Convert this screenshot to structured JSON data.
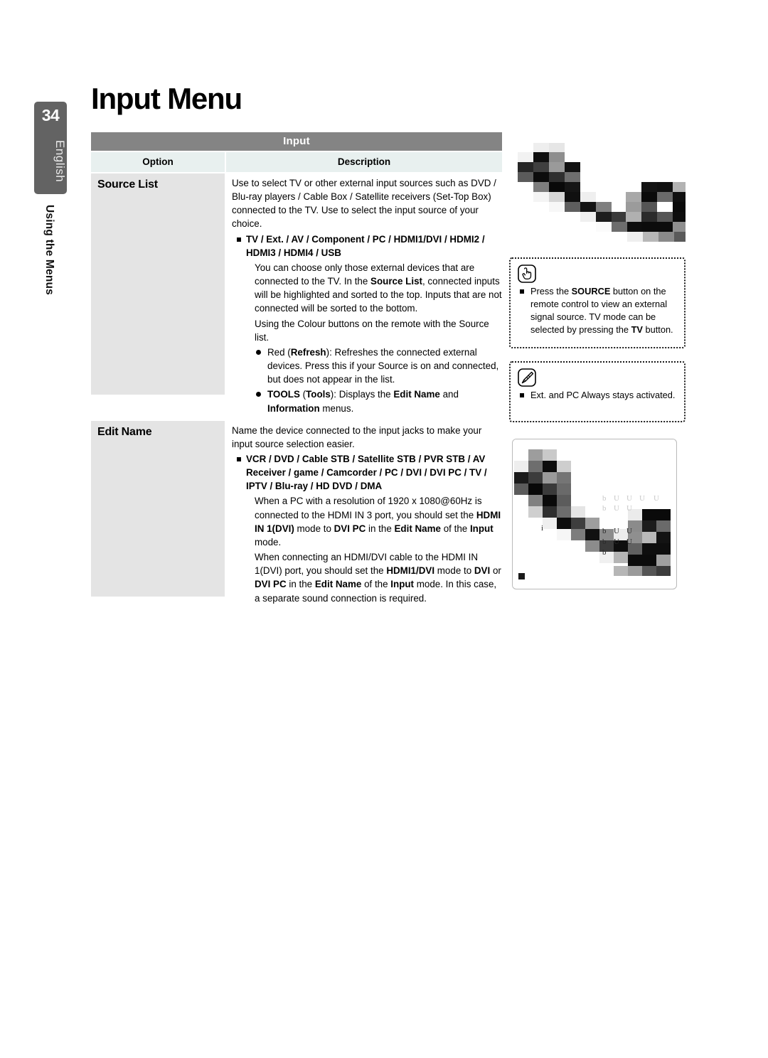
{
  "page": {
    "number": "34",
    "language": "English",
    "section": "Using the Menus",
    "title": "Input Menu"
  },
  "table": {
    "title": "Input",
    "headers": {
      "option": "Option",
      "description": "Description"
    },
    "rows": [
      {
        "option": "Source List",
        "intro": "Use to select TV or other external input sources such as DVD / Blu-ray players / Cable Box / Satellite receivers (Set-Top Box) connected to the TV. Use to select the input source of your choice.",
        "bullet_bold": "TV / Ext. / AV / Component / PC / HDMI1/DVI / HDMI2 / HDMI3 / HDMI4 / USB",
        "para_1_a": "You can choose only those external devices that are connected to the TV. In the ",
        "para_1_b": "Source List",
        "para_1_c": ", connected inputs will be highlighted and sorted to the top. Inputs that are not connected will be sorted to the bottom.",
        "para_2": "Using the Colour buttons on the remote with the Source list.",
        "dot_1_a": "Red (",
        "dot_1_b": "Refresh",
        "dot_1_c": "): Refreshes the connected external devices. Press this if your Source is on and connected, but does not appear in the list.",
        "dot_2_a": "TOOLS",
        "dot_2_b": " (",
        "dot_2_c": "Tools",
        "dot_2_d": "): Displays the ",
        "dot_2_e": "Edit Name",
        "dot_2_f": " and ",
        "dot_2_g": "Information",
        "dot_2_h": " menus."
      },
      {
        "option": "Edit Name",
        "intro": "Name the device connected to the input jacks to make your input source selection easier.",
        "bullet_bold": "VCR / DVD / Cable STB / Satellite STB / PVR STB / AV Receiver / game / Camcorder / PC / DVI / DVI PC / TV / IPTV / Blu-ray / HD DVD / DMA",
        "para_1_a": "When a PC with a resolution of 1920 x 1080@60Hz is connected to the HDMI IN 3 port, you should set the ",
        "para_1_b": "HDMI IN 1(DVI)",
        "para_1_c": " mode to ",
        "para_1_d": "DVI PC",
        "para_1_e": " in the ",
        "para_1_f": "Edit Name",
        "para_1_g": " of the ",
        "para_1_h": "Input",
        "para_1_i": " mode.",
        "para_2_a": "When connecting an HDMI/DVI cable to the HDMI IN 1(DVI) port, you should set the ",
        "para_2_b": "HDMI1/DVI",
        "para_2_c": " mode to ",
        "para_2_d": "DVI",
        "para_2_e": " or ",
        "para_2_f": "DVI PC",
        "para_2_g": " in the ",
        "para_2_h": "Edit Name",
        "para_2_i": " of the ",
        "para_2_j": "Input",
        "para_2_k": " mode. In this case, a separate sound connection is required."
      }
    ]
  },
  "notes": [
    {
      "icon": "hand-press-icon",
      "text_a": "Press the ",
      "text_b": "SOURCE",
      "text_c": " button on the remote control to view an external signal source. TV mode can be selected by pressing the ",
      "text_d": "TV",
      "text_e": " button."
    },
    {
      "icon": "pencil-note-icon",
      "text_a": "Ext. and PC Always stays activated.",
      "text_b": "",
      "text_c": "",
      "text_d": "",
      "text_e": ""
    }
  ],
  "figures": [
    {
      "name": "osd-screenshot-top",
      "caption": ""
    },
    {
      "name": "osd-screenshot-bottom",
      "caption": ""
    }
  ],
  "colors": {
    "tab": "#636363",
    "table_title_bg": "#848484",
    "table_header_bg": "#e8f0ef",
    "option_cell_bg": "#e4e4e4"
  }
}
